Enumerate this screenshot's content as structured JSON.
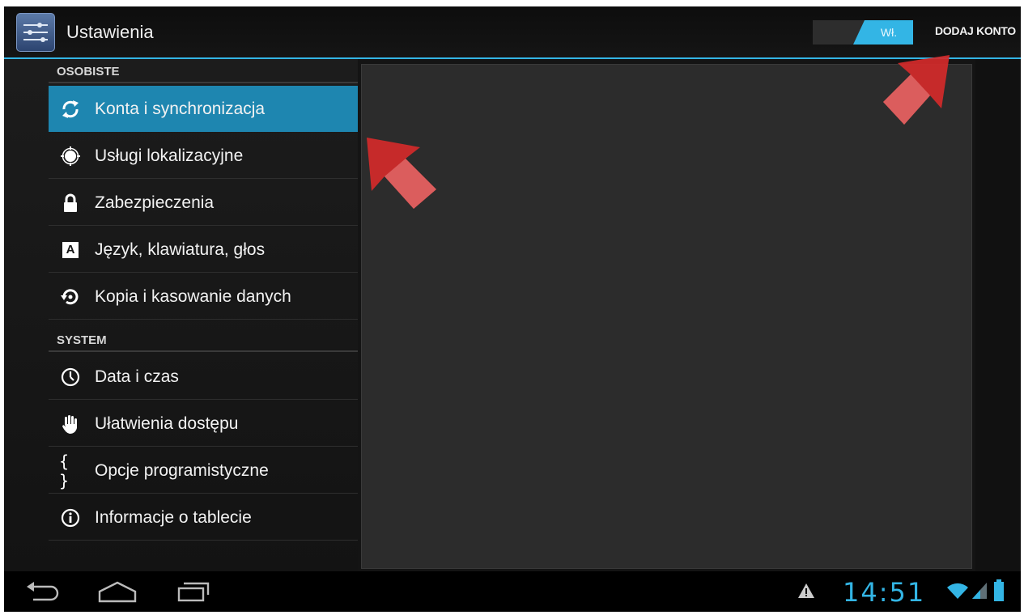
{
  "app": {
    "title": "Ustawienia",
    "icon": "settings-sliders-icon"
  },
  "toggle": {
    "label": "Wł.",
    "state": "on"
  },
  "action": {
    "add_account": "DODAJ KONTO"
  },
  "sections": [
    {
      "header": "OSOBISTE",
      "items": [
        {
          "label": "Konta i synchronizacja",
          "icon": "sync-icon",
          "active": true
        },
        {
          "label": "Usługi lokalizacyjne",
          "icon": "location-icon"
        },
        {
          "label": "Zabezpieczenia",
          "icon": "lock-icon"
        },
        {
          "label": "Język, klawiatura, głos",
          "icon": "language-icon",
          "icon_text": "A"
        },
        {
          "label": "Kopia i kasowanie danych",
          "icon": "backup-restore-icon"
        }
      ]
    },
    {
      "header": "SYSTEM",
      "items": [
        {
          "label": "Data i czas",
          "icon": "clock-icon"
        },
        {
          "label": "Ułatwienia dostępu",
          "icon": "hand-icon"
        },
        {
          "label": "Opcje programistyczne",
          "icon": "braces-icon",
          "icon_text": "{ }"
        },
        {
          "label": "Informacje o tablecie",
          "icon": "info-icon"
        }
      ]
    }
  ],
  "statusbar": {
    "time": "14:51",
    "icons": [
      "warning-icon",
      "wifi-icon",
      "signal-icon",
      "battery-icon"
    ]
  },
  "navbar": {
    "buttons": [
      "back",
      "home",
      "recent-apps"
    ]
  },
  "colors": {
    "accent": "#33b5e5",
    "selected": "#1e86b0",
    "annotation_arrow": "#d42a2a"
  }
}
